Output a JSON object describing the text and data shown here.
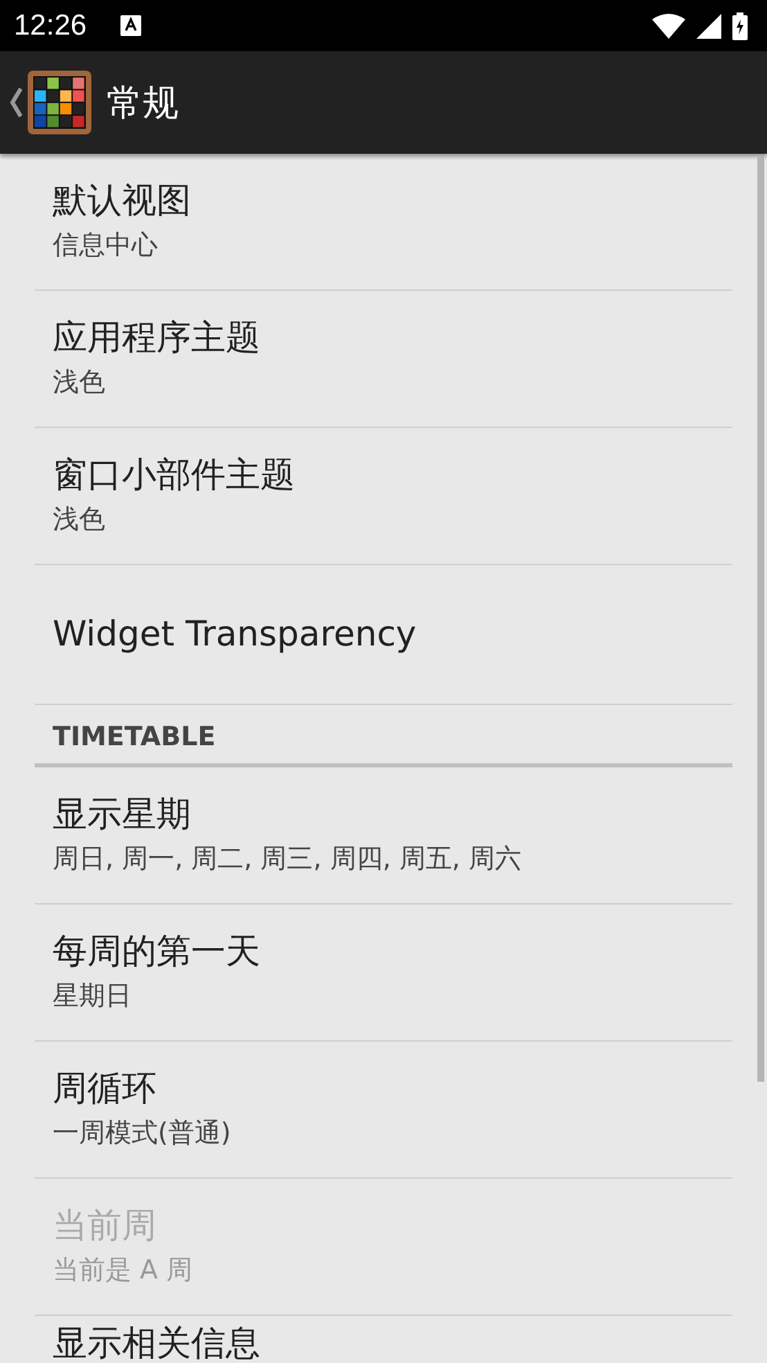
{
  "status_bar": {
    "time": "12:26"
  },
  "toolbar": {
    "title": "常规"
  },
  "items": [
    {
      "kind": "preference",
      "title": "默认视图",
      "summary": "信息中心",
      "disabled": false
    },
    {
      "kind": "preference",
      "title": "应用程序主题",
      "summary": "浅色",
      "disabled": false
    },
    {
      "kind": "preference",
      "title": "窗口小部件主题",
      "summary": "浅色",
      "disabled": false
    },
    {
      "kind": "preference",
      "title": "Widget Transparency",
      "disabled": false
    },
    {
      "kind": "header",
      "title": "TIMETABLE"
    },
    {
      "kind": "preference",
      "title": "显示星期",
      "summary": "周日, 周一, 周二, 周三, 周四, 周五, 周六",
      "disabled": false
    },
    {
      "kind": "preference",
      "title": "每周的第一天",
      "summary": "星期日",
      "disabled": false
    },
    {
      "kind": "preference",
      "title": "周循环",
      "summary": "一周模式(普通)",
      "disabled": false
    },
    {
      "kind": "preference",
      "title": "当前周",
      "summary": "当前是 A 周",
      "disabled": true
    },
    {
      "kind": "preference",
      "title": "显示相关信息",
      "disabled": false
    }
  ]
}
